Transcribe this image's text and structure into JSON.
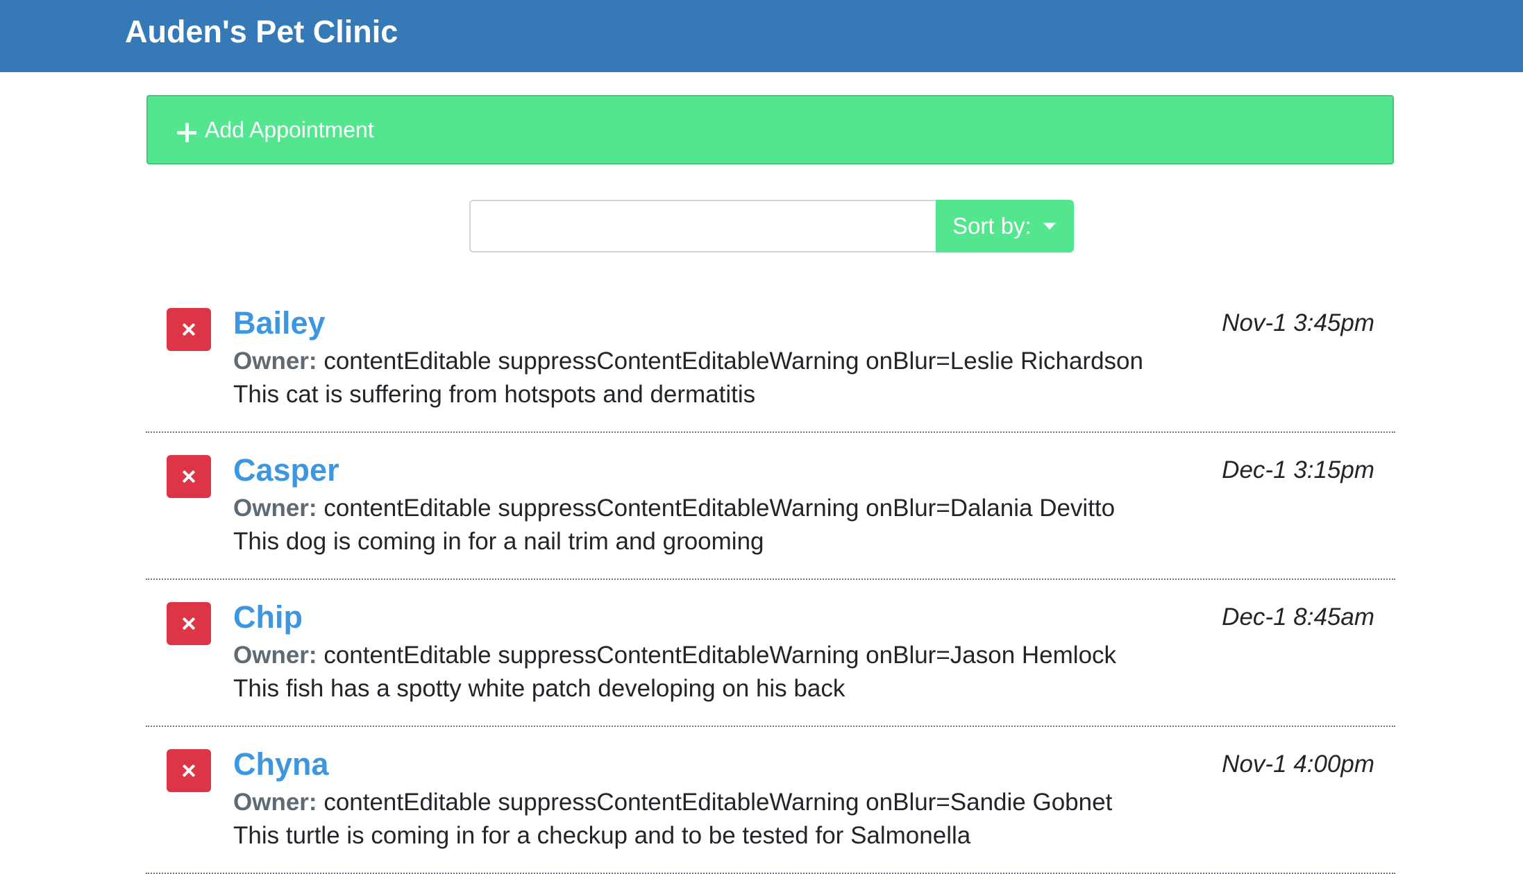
{
  "header": {
    "title": "Auden's Pet Clinic"
  },
  "add_appointment": {
    "label": "Add Appointment",
    "icon": "plus-icon"
  },
  "search": {
    "value": "",
    "placeholder": ""
  },
  "sort": {
    "label": "Sort by:",
    "icon": "caret-down-icon"
  },
  "appointments": [
    {
      "pet_name": "Bailey",
      "owner_label": "Owner:",
      "owner": "contentEditable suppressContentEditableWarning onBlur=Leslie Richardson",
      "notes": "This cat is suffering from hotspots and dermatitis",
      "date": "Nov-1 3:45pm"
    },
    {
      "pet_name": "Casper",
      "owner_label": "Owner:",
      "owner": "contentEditable suppressContentEditableWarning onBlur=Dalania Devitto",
      "notes": "This dog is coming in for a nail trim and grooming",
      "date": "Dec-1 3:15pm"
    },
    {
      "pet_name": "Chip",
      "owner_label": "Owner:",
      "owner": "contentEditable suppressContentEditableWarning onBlur=Jason Hemlock",
      "notes": "This fish has a spotty white patch developing on his back",
      "date": "Dec-1 8:45am"
    },
    {
      "pet_name": "Chyna",
      "owner_label": "Owner:",
      "owner": "contentEditable suppressContentEditableWarning onBlur=Sandie Gobnet",
      "notes": "This turtle is coming in for a checkup and to be tested for Salmonella",
      "date": "Nov-1 4:00pm"
    }
  ],
  "colors": {
    "navbar": "#357ab7",
    "add_bar": "#53e68f",
    "delete": "#dc3545",
    "pet_name": "#3d97e0"
  }
}
